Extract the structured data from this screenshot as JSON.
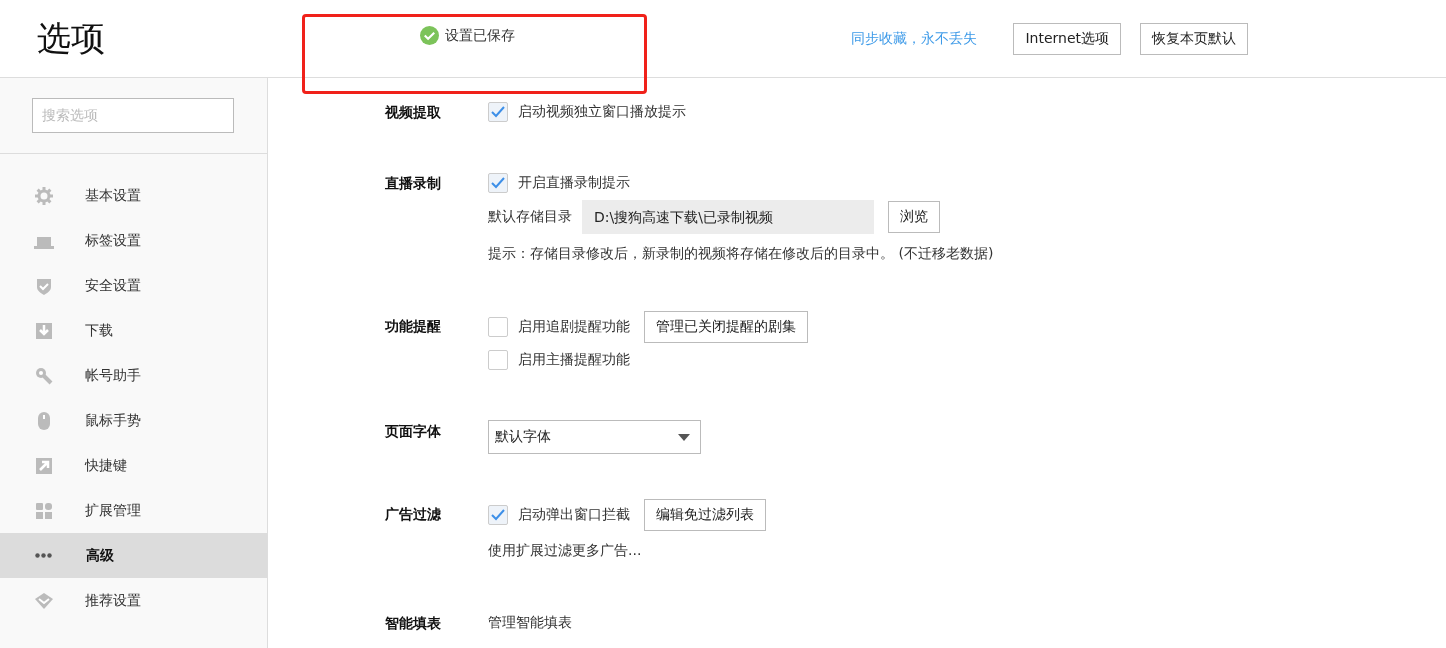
{
  "header": {
    "title": "选项",
    "status": "设置已保存",
    "sync_link": "同步收藏，永不丢失",
    "buttons": [
      "Internet选项",
      "恢复本页默认"
    ]
  },
  "sidebar": {
    "search": {
      "placeholder": "搜索选项"
    },
    "items": [
      {
        "label": "基本设置",
        "selected": false
      },
      {
        "label": "标签设置",
        "selected": false
      },
      {
        "label": "安全设置",
        "selected": false
      },
      {
        "label": "下载",
        "selected": false
      },
      {
        "label": "帐号助手",
        "selected": false
      },
      {
        "label": "鼠标手势",
        "selected": false
      },
      {
        "label": "快捷键",
        "selected": false
      },
      {
        "label": "扩展管理",
        "selected": false
      },
      {
        "label": "高级",
        "selected": true
      },
      {
        "label": "推荐设置",
        "selected": false
      }
    ]
  },
  "sections": [
    {
      "label": "视频提取",
      "rows": [
        {
          "kind": "checkbox",
          "label": "启动视频独立窗口播放提示",
          "checked": true
        }
      ]
    },
    {
      "label": "直播录制",
      "rows": [
        {
          "kind": "checkbox",
          "label": "开启直播录制提示",
          "checked": true
        },
        {
          "kind": "path",
          "label": "默认存储目录",
          "value": "D:\\搜狗高速下载\\已录制视频",
          "button": "浏览"
        },
        {
          "kind": "note",
          "text": "提示：存储目录修改后，新录制的视频将存储在修改后的目录中。 (不迁移老数据)"
        }
      ]
    },
    {
      "label": "功能提醒",
      "rows": [
        {
          "kind": "checkbox",
          "label": "启用追剧提醒功能",
          "checked": false,
          "button": "管理已关闭提醒的剧集"
        },
        {
          "kind": "checkbox",
          "label": "启用主播提醒功能",
          "checked": false
        }
      ]
    },
    {
      "label": "页面字体",
      "rows": [
        {
          "kind": "select",
          "value": "默认字体"
        }
      ]
    },
    {
      "label": "广告过滤",
      "rows": [
        {
          "kind": "checkbox",
          "label": "启动弹出窗口拦截",
          "checked": true,
          "button": "编辑免过滤列表"
        },
        {
          "kind": "note",
          "text": "使用扩展过滤更多广告..."
        }
      ]
    },
    {
      "label": "智能填表",
      "rows": [
        {
          "kind": "link",
          "text": "管理智能填表"
        }
      ]
    }
  ]
}
